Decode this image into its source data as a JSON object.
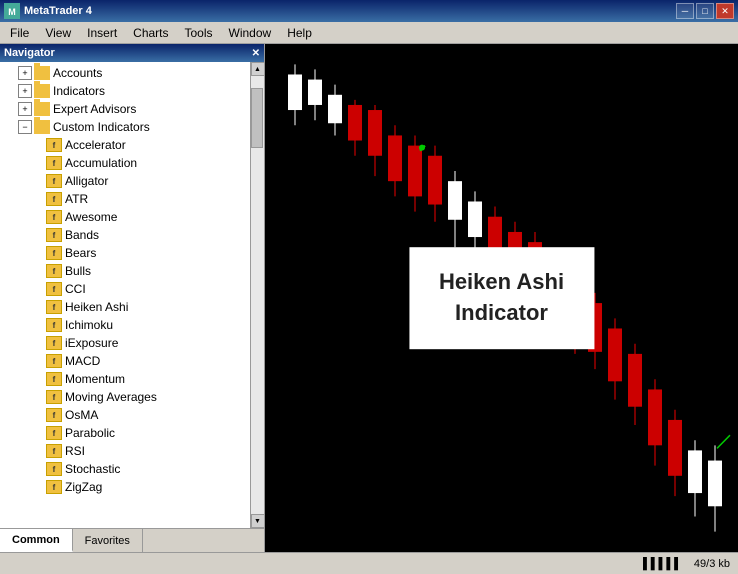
{
  "titlebar": {
    "title": "MetaTrader 4",
    "minimize": "─",
    "maximize": "□",
    "close": "✕"
  },
  "menubar": {
    "items": [
      "File",
      "View",
      "Insert",
      "Charts",
      "Tools",
      "Window",
      "Help"
    ]
  },
  "navigator": {
    "title": "Navigator",
    "close": "✕",
    "tree": {
      "accounts": "Accounts",
      "indicators": "Indicators",
      "expertAdvisors": "Expert Advisors",
      "customIndicators": "Custom Indicators",
      "items": [
        "Accelerator",
        "Accumulation",
        "Alligator",
        "ATR",
        "Awesome",
        "Bands",
        "Bears",
        "Bulls",
        "CCI",
        "Heiken Ashi",
        "Ichimoku",
        "iExposure",
        "MACD",
        "Momentum",
        "Moving Averages",
        "OsMA",
        "Parabolic",
        "RSI",
        "Stochastic",
        "ZigZag"
      ]
    },
    "tabs": [
      "Common",
      "Favorites"
    ]
  },
  "chart": {
    "label_line1": "Heiken Ashi",
    "label_line2": "Indicator"
  },
  "statusbar": {
    "chart_icon": "▌▌▌▌▌",
    "memory": "49/3 kb"
  }
}
